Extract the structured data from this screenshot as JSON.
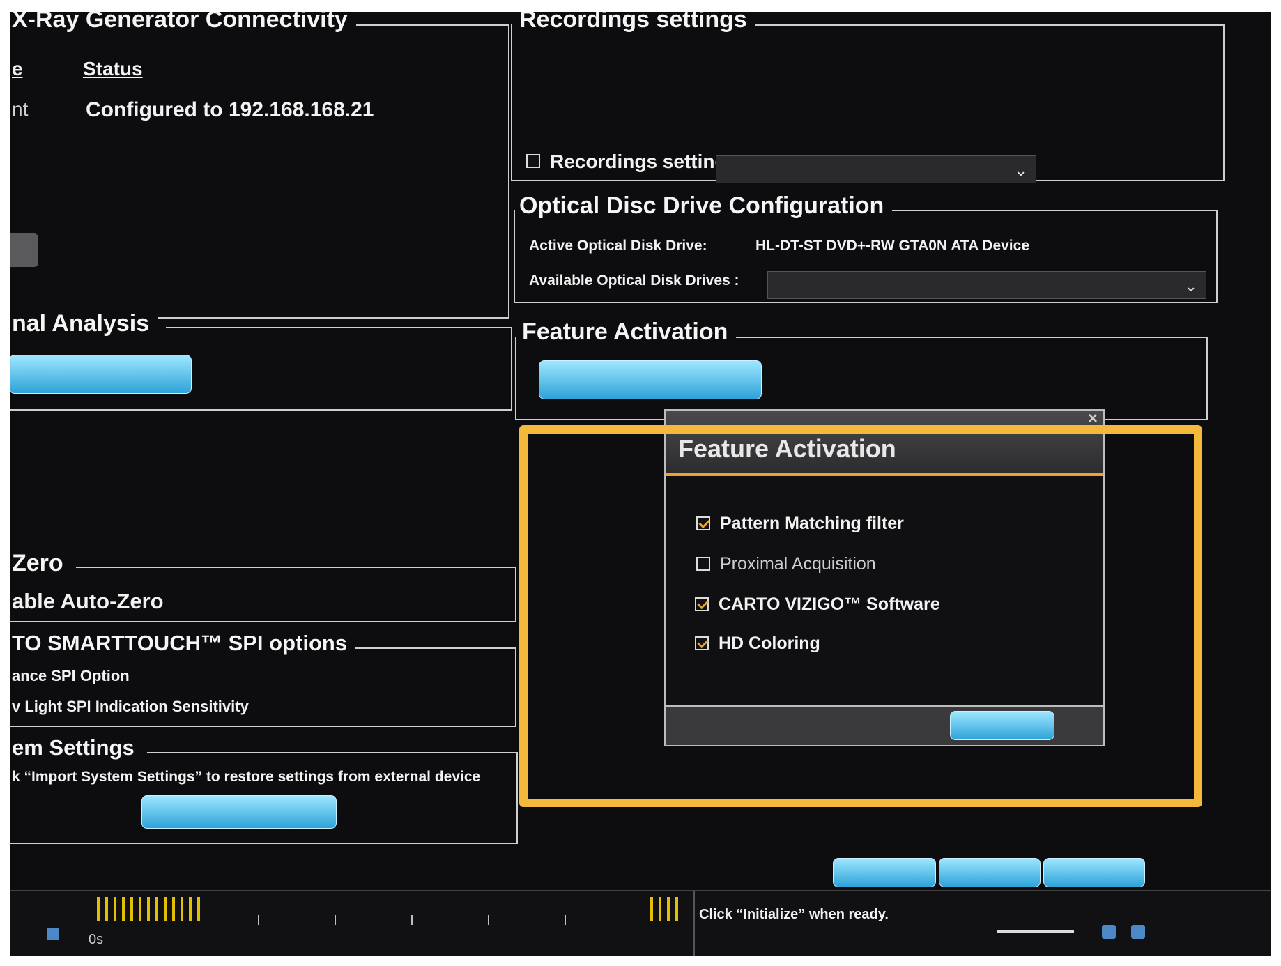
{
  "xray_group": {
    "title": "X-Ray Generator Connectivity",
    "col_left": "e",
    "col_status": "Status",
    "row_left": "nt",
    "row_status": "Configured to 192.168.168.21"
  },
  "signal_group": {
    "title": "nal Analysis"
  },
  "autozero_group": {
    "title": "Zero",
    "option": "able Auto-Zero"
  },
  "smarttouch_group": {
    "title": "TO SMARTTOUCH™ SPI options",
    "option1": "ance SPI Option",
    "option2": "v Light SPI Indication Sensitivity"
  },
  "system_group": {
    "title": "em Settings",
    "hint": "k “Import System Settings” to restore settings from external device"
  },
  "recordings_group": {
    "title": "Recordings settings",
    "checkbox_label": "Recordings settings",
    "checked": false
  },
  "optical_group": {
    "title": "Optical Disc Drive Configuration",
    "active_label": "Active Optical Disk Drive:",
    "active_value": "HL-DT-ST DVD+-RW GTA0N ATA Device",
    "available_label": "Available Optical Disk Drives :"
  },
  "feature_group": {
    "title": "Feature Activation"
  },
  "dialog": {
    "title": "Feature Activation",
    "close": "×",
    "options": [
      {
        "label": "Pattern Matching filter",
        "checked": true
      },
      {
        "label": "Proximal Acquisition",
        "checked": false
      },
      {
        "label": "CARTO VIZIGO™ Software",
        "checked": true
      },
      {
        "label": "HD Coloring",
        "checked": true
      }
    ]
  },
  "status_bar": {
    "message": "Click “Initialize” when ready.",
    "time_label": "0s"
  },
  "colors": {
    "accent_orange": "#f0a030",
    "highlight_frame": "#f2b93b",
    "button_blue": "#2ea3d8"
  }
}
